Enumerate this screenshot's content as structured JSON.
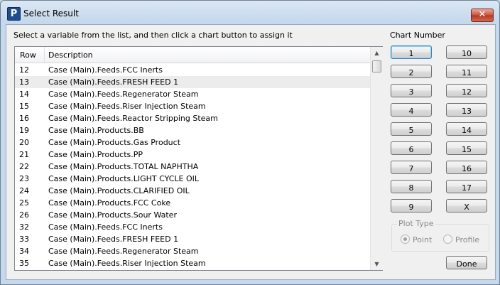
{
  "window": {
    "title": "Select Result",
    "app_icon_letter": "P",
    "close_glyph": "✕"
  },
  "instruction": "Select a variable from the list, and then click a chart button to assign it",
  "list": {
    "columns": [
      "Row",
      "Description"
    ],
    "rows": [
      {
        "row": "12",
        "desc": "Case (Main).Feeds.FCC Inerts"
      },
      {
        "row": "13",
        "desc": "Case (Main).Feeds.FRESH FEED 1"
      },
      {
        "row": "14",
        "desc": "Case (Main).Feeds.Regenerator Steam"
      },
      {
        "row": "15",
        "desc": "Case (Main).Feeds.Riser Injection Steam"
      },
      {
        "row": "16",
        "desc": "Case (Main).Feeds.Reactor Stripping Steam"
      },
      {
        "row": "19",
        "desc": "Case (Main).Products.BB"
      },
      {
        "row": "20",
        "desc": "Case (Main).Products.Gas Product"
      },
      {
        "row": "21",
        "desc": "Case (Main).Products.PP"
      },
      {
        "row": "22",
        "desc": "Case (Main).Products.TOTAL NAPHTHA"
      },
      {
        "row": "23",
        "desc": "Case (Main).Products.LIGHT CYCLE OIL"
      },
      {
        "row": "24",
        "desc": "Case (Main).Products.CLARIFIED OIL"
      },
      {
        "row": "25",
        "desc": "Case (Main).Products.FCC Coke"
      },
      {
        "row": "26",
        "desc": "Case (Main).Products.Sour Water"
      },
      {
        "row": "32",
        "desc": "Case (Main).Feeds.FCC Inerts"
      },
      {
        "row": "33",
        "desc": "Case (Main).Feeds.FRESH FEED 1"
      },
      {
        "row": "34",
        "desc": "Case (Main).Feeds.Regenerator Steam"
      },
      {
        "row": "35",
        "desc": "Case (Main).Feeds.Riser Injection Steam"
      }
    ]
  },
  "chart_number_label": "Chart Number",
  "chart_buttons_left": [
    "1",
    "2",
    "3",
    "4",
    "5",
    "6",
    "7",
    "8",
    "9"
  ],
  "chart_buttons_right": [
    "10",
    "11",
    "12",
    "13",
    "14",
    "15",
    "16",
    "17",
    "X"
  ],
  "plot_type": {
    "title": "Plot Type",
    "options": [
      "Point",
      "Profile"
    ],
    "selected": "Point"
  },
  "done_label": "Done"
}
